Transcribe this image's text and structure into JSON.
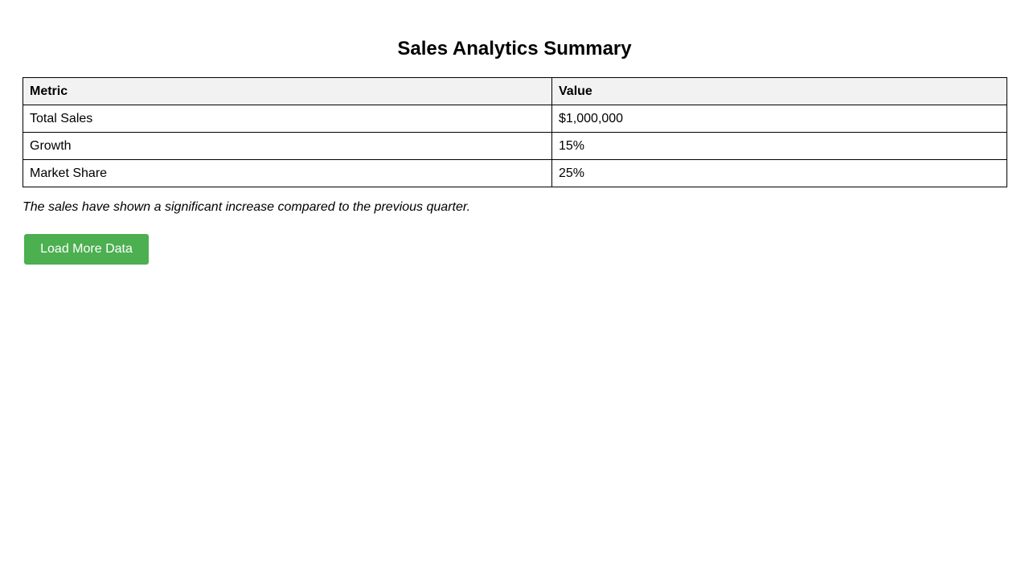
{
  "page": {
    "title": "Sales Analytics Summary"
  },
  "table": {
    "headers": [
      "Metric",
      "Value"
    ],
    "rows": [
      [
        "Total Sales",
        "$1,000,000"
      ],
      [
        "Growth",
        "15%"
      ],
      [
        "Market Share",
        "25%"
      ]
    ]
  },
  "summary": {
    "note": "The sales have shown a significant increase compared to the previous quarter."
  },
  "actions": {
    "load_more_label": "Load More Data"
  },
  "colors": {
    "button_background": "#4caf50",
    "header_background": "#f2f2f2",
    "border": "#000000"
  }
}
